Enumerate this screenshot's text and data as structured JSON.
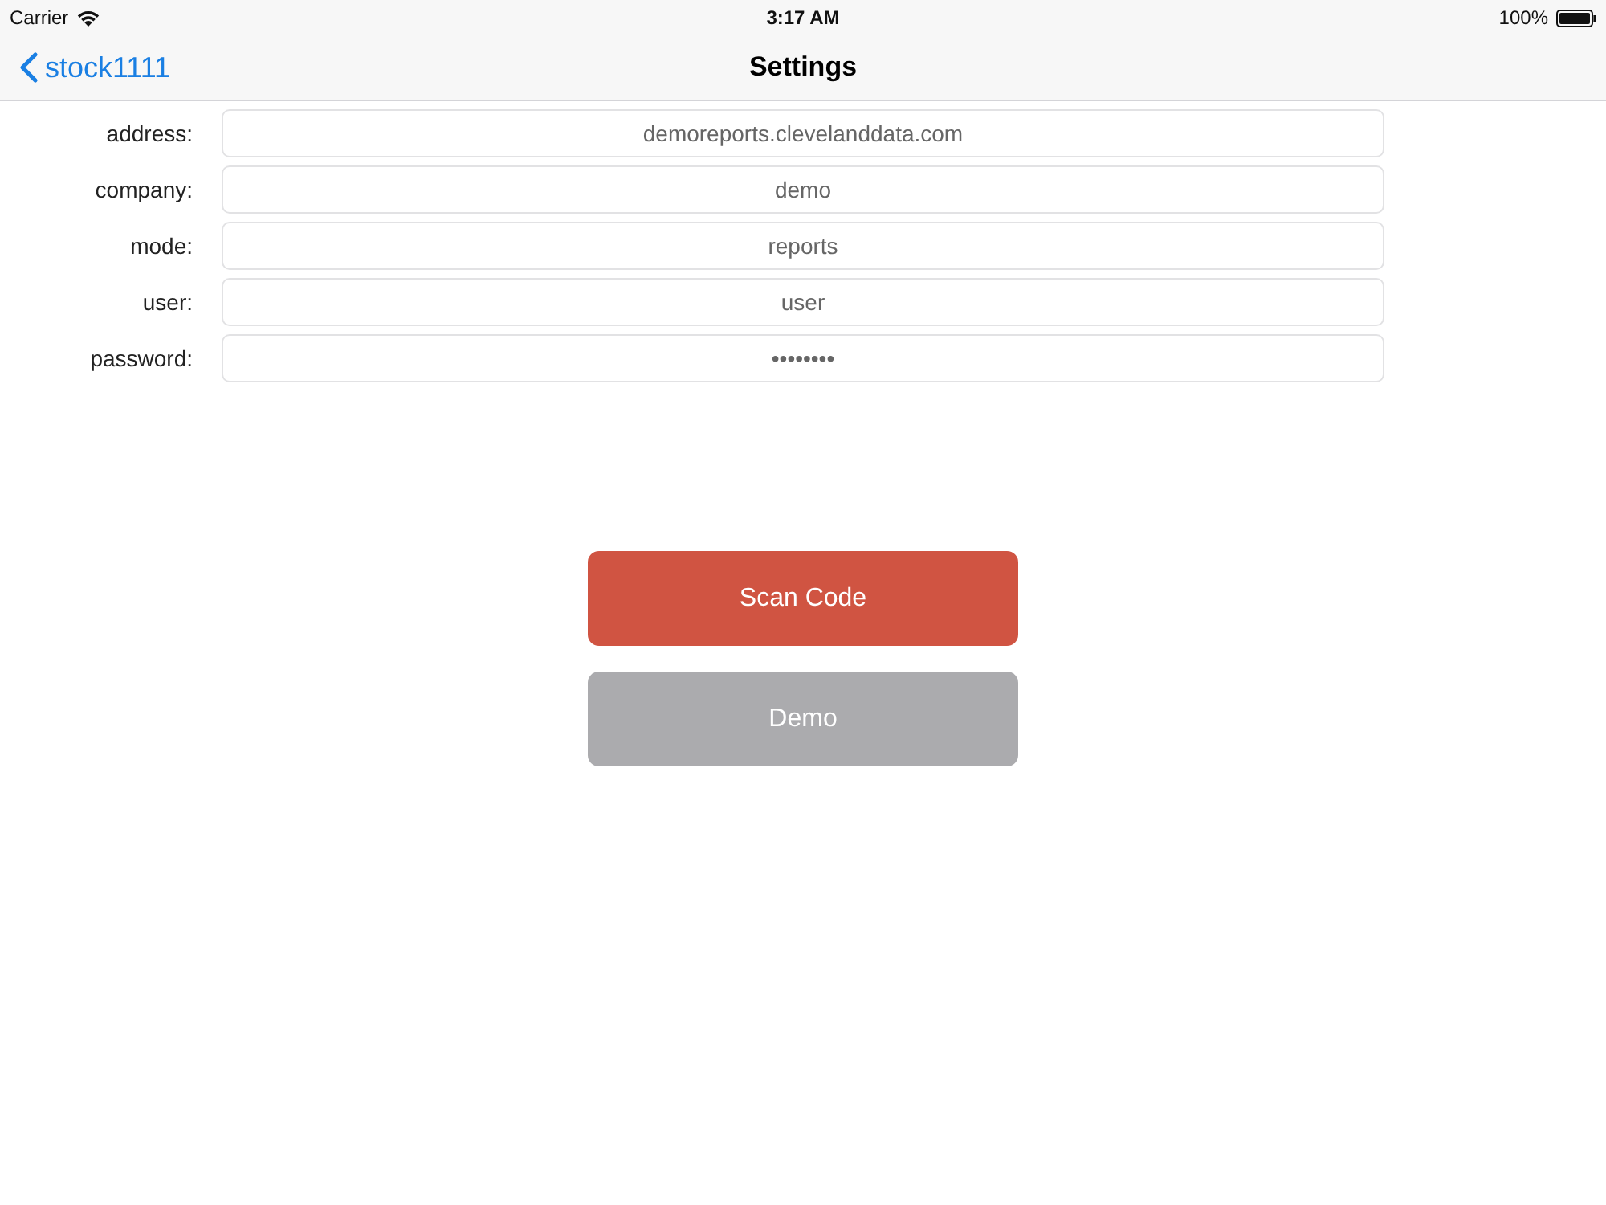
{
  "status_bar": {
    "carrier": "Carrier",
    "time": "3:17 AM",
    "battery": "100%"
  },
  "nav_bar": {
    "back": "stock1111",
    "title": "Settings"
  },
  "fields": [
    {
      "label": "address:",
      "value": "demoreports.clevelanddata.com"
    },
    {
      "label": "company:",
      "value": "demo"
    },
    {
      "label": "mode:",
      "value": "reports"
    },
    {
      "label": "user:",
      "value": "user"
    },
    {
      "label": "password:",
      "value": "••••••••"
    }
  ],
  "buttons": [
    {
      "label": "Scan Code",
      "kind": "primary"
    },
    {
      "label": "Demo",
      "kind": "secondary"
    }
  ]
}
